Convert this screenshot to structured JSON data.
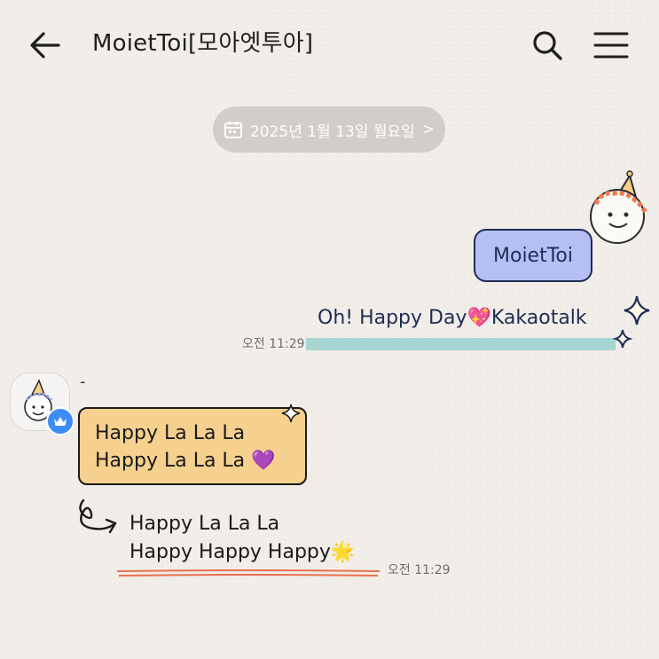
{
  "header": {
    "title": "MoietToi[모아엣투아]",
    "back_icon": "arrow-left-icon",
    "search_icon": "search-icon",
    "menu_icon": "hamburger-menu-icon"
  },
  "date_divider": {
    "label": "2025년 1월 13일 월요일",
    "chevron": ">"
  },
  "messages": {
    "sent": {
      "bubble_text": "MoietToi",
      "line_text": "Oh! Happy Day💖Kakaotalk",
      "time": "오전 11:29"
    },
    "received": {
      "sender_name": "-",
      "bubble_line1": "Happy La La La",
      "bubble_line2": "Happy La La La 💜",
      "text_line1": "Happy La La La",
      "text_line2": "Happy Happy Happy🌟",
      "time": "오전 11:29"
    }
  },
  "colors": {
    "background": "#f1ede8",
    "sent_bubble": "#b5bff4",
    "received_bubble": "#f6d08e",
    "sent_highlight": "#a7d6d2",
    "received_underline": "#e8704e",
    "badge": "#3d8cf4",
    "date_pill": "#d1cdc8"
  }
}
